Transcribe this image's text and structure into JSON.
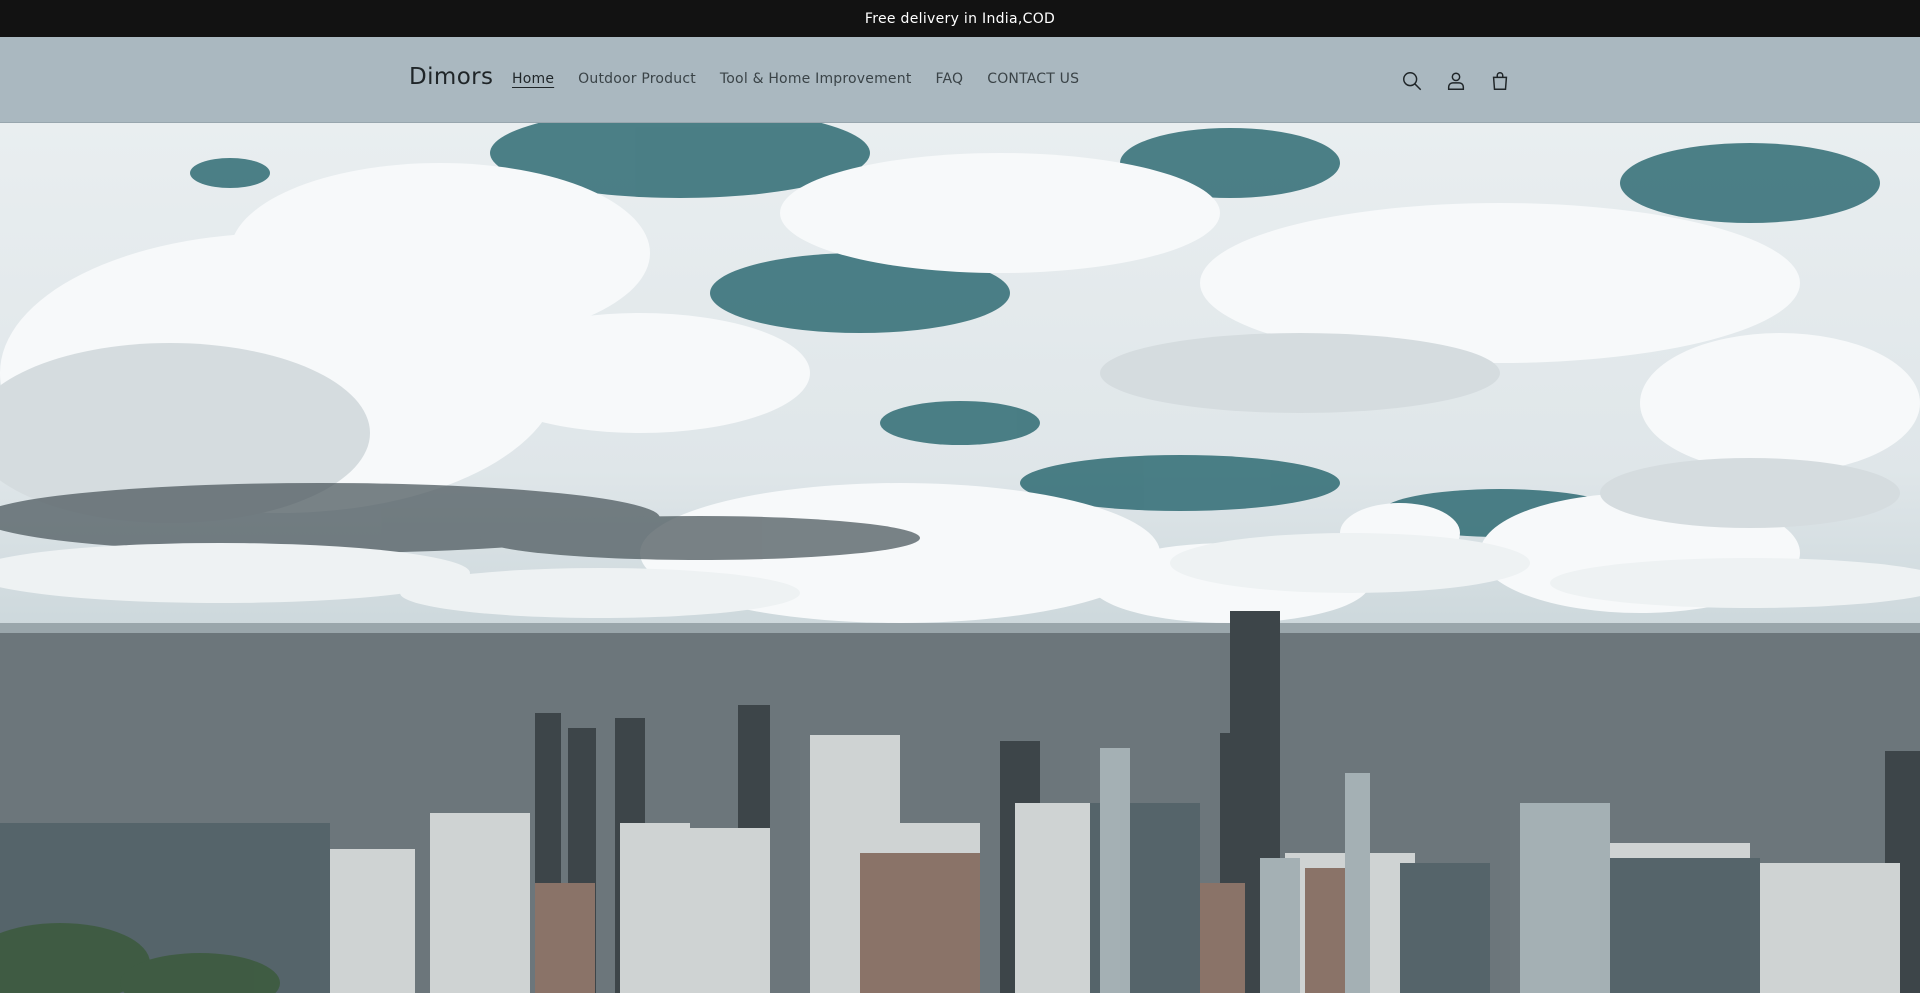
{
  "announcement": {
    "text": "Free delivery in India,COD"
  },
  "header": {
    "logo": "Dimors",
    "nav": [
      {
        "label": "Home",
        "active": true
      },
      {
        "label": "Outdoor Product",
        "active": false
      },
      {
        "label": "Tool & Home Improvement",
        "active": false
      },
      {
        "label": "FAQ",
        "active": false
      },
      {
        "label": "CONTACT US",
        "active": false
      }
    ],
    "icons": [
      "search-icon",
      "account-icon",
      "cart-icon"
    ]
  },
  "hero": {
    "image": "city-skyline-under-cloudy-sky"
  },
  "colors": {
    "announcement_bg": "#121212",
    "header_bg": "#aab8c0",
    "sky_teal": "#2f6b73"
  }
}
